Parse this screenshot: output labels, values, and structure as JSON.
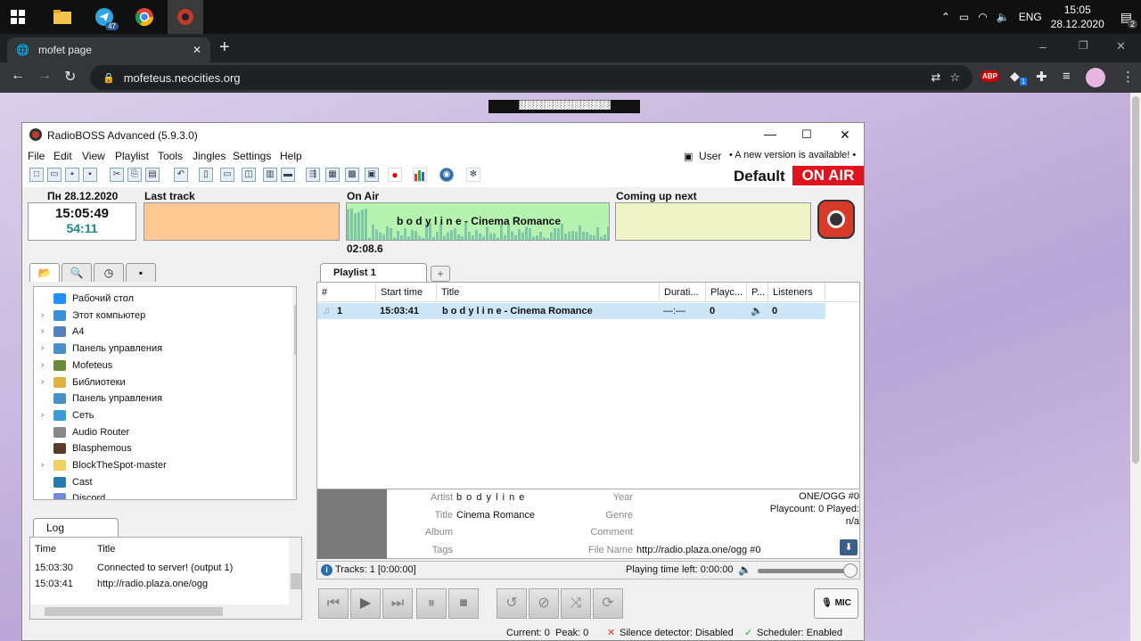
{
  "taskbar": {
    "telegram_badge": "47",
    "language": "ENG",
    "time": "15:05",
    "date": "28.12.2020",
    "notifications": "2"
  },
  "browser": {
    "tab_title": "mofet page",
    "new_tab": "+",
    "url": "mofeteus.neocities.org",
    "abp_label": "ABP",
    "ext_badge": "1"
  },
  "page": {
    "banner_text": "▓▓▓▓▓▓▓▓▓▓▓▓▓▓▓▓▓▓▓▓▓▓▓"
  },
  "app": {
    "title": "RadioBOSS Advanced (5.9.3.0)",
    "menu": [
      "File",
      "Edit",
      "View",
      "Playlist",
      "Tools",
      "Jingles",
      "Settings",
      "Help"
    ],
    "user_label": "User",
    "update_notice": "• A new version is available! •",
    "profile": "Default",
    "on_air_badge": "ON AIR",
    "date": "Пн 28.12.2020",
    "clock": "15:05:49",
    "countdown": "54:11",
    "last_track_label": "Last track",
    "on_air_label": "On Air",
    "on_air_track": "b o d y l i n e - Cinema Romance",
    "elapsed": "02:08.6",
    "coming_up_label": "Coming up next",
    "nav_tabs": [
      "folder-tab",
      "search-tab",
      "history-tab",
      "scheduler-tab"
    ],
    "tree": [
      {
        "label": "Рабочий стол",
        "arrow": false,
        "color": "#1e90ff"
      },
      {
        "label": "Этот компьютер",
        "arrow": true,
        "color": "#3a8fd6"
      },
      {
        "label": "A4",
        "arrow": true,
        "color": "#5a7fbf"
      },
      {
        "label": "Панель управления",
        "arrow": true,
        "color": "#4a90c8"
      },
      {
        "label": "Mofeteus",
        "arrow": true,
        "color": "#6a8a3a"
      },
      {
        "label": "Библиотеки",
        "arrow": true,
        "color": "#e0b040"
      },
      {
        "label": "Панель управления",
        "arrow": false,
        "color": "#4a90c8"
      },
      {
        "label": "Сеть",
        "arrow": true,
        "color": "#3a9ad6"
      },
      {
        "label": "Audio Router",
        "arrow": false,
        "color": "#888888"
      },
      {
        "label": "Blasphemous",
        "arrow": false,
        "color": "#5a3a2a"
      },
      {
        "label": "BlockTheSpot-master",
        "arrow": true,
        "color": "#f0d060"
      },
      {
        "label": "Cast",
        "arrow": false,
        "color": "#2a7ab0"
      },
      {
        "label": "Discord",
        "arrow": false,
        "color": "#7289da"
      }
    ],
    "log": {
      "tab": "Log",
      "col_time": "Time",
      "col_title": "Title",
      "rows": [
        {
          "time": "15:03:30",
          "title": "Connected to server! (output 1)"
        },
        {
          "time": "15:03:41",
          "title": "http://radio.plaza.one/ogg"
        }
      ]
    },
    "playlist": {
      "tab": "Playlist 1",
      "add_tab": "+",
      "headers": {
        "num": "#",
        "start": "Start time",
        "title": "Title",
        "duration": "Durati...",
        "playcount": "Playc...",
        "p": "P...",
        "listeners": "Listeners"
      },
      "rows": [
        {
          "num": "1",
          "start": "15:03:41",
          "title": "b o d y l i n e - Cinema Romance",
          "duration": "—:—",
          "playcount": "0",
          "listeners": "0"
        }
      ]
    },
    "track_info": {
      "artist_label": "Artist",
      "artist": "b o d y l i n e",
      "title_label": "Title",
      "title": "Cinema Romance",
      "album_label": "Album",
      "tags_label": "Tags",
      "year_label": "Year",
      "genre_label": "Genre",
      "comment_label": "Comment",
      "filename_label": "File Name",
      "filename": "http://radio.plaza.one/ogg #0",
      "format": "ONE/OGG #0",
      "playcount_line": "Playcount: 0  Played:",
      "played_value": "n/a"
    },
    "tracks_summary": "Tracks: 1 [0:00:00]",
    "playing_time_left": "Playing time left: 0:00:00",
    "volume_percent": 100,
    "mic_label": "MIC",
    "status": {
      "current": "Current: 0",
      "peak": "Peak: 0",
      "silence": "Silence detector: Disabled",
      "scheduler": "Scheduler: Enabled"
    }
  }
}
